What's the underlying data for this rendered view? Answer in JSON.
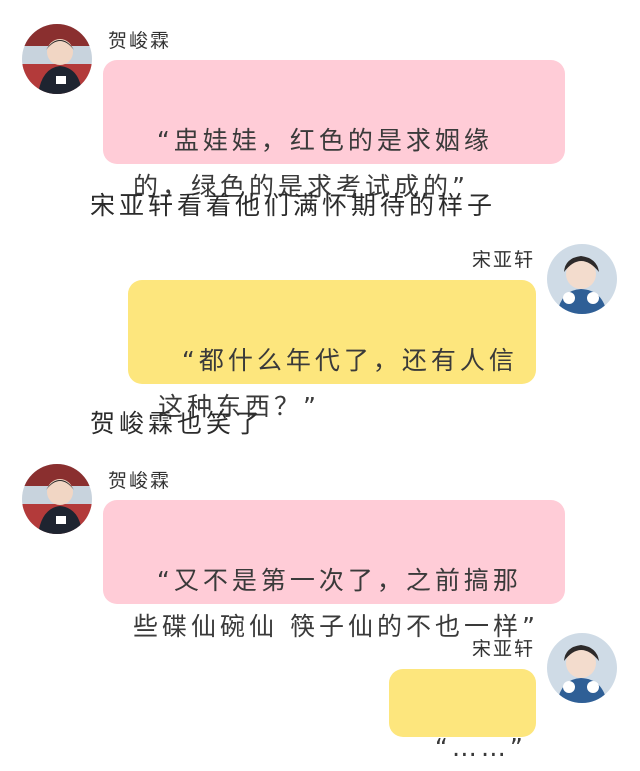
{
  "chat": {
    "messages": [
      {
        "speaker": "贺峻霖",
        "side": "left",
        "bubble_color": "#ffccd7",
        "avatar_icon": "person-avatar-icon",
        "text": "“盅娃娃，红色的是求姻缘的，绿色的是求考试成的”"
      },
      {
        "narration": "宋亚轩看着他们满怀期待的样子"
      },
      {
        "speaker": "宋亚轩",
        "side": "right",
        "bubble_color": "#fde67d",
        "avatar_icon": "person-avatar-icon",
        "text": "“都什么年代了，还有人信这种东西？”"
      },
      {
        "narration": "贺峻霖也笑了"
      },
      {
        "speaker": "贺峻霖",
        "side": "left",
        "bubble_color": "#ffccd7",
        "avatar_icon": "person-avatar-icon",
        "text": "“又不是第一次了，之前搞那些碟仙碗仙 筷子仙的不也一样”"
      },
      {
        "speaker": "宋亚轩",
        "side": "right",
        "bubble_color": "#fde67d",
        "avatar_icon": "person-avatar-icon",
        "text": "“……”"
      }
    ]
  }
}
